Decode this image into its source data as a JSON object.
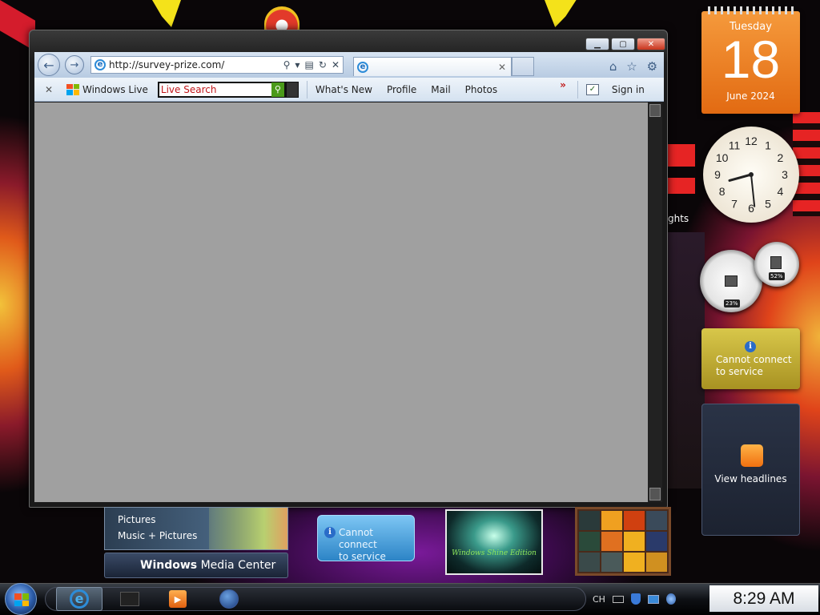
{
  "browser": {
    "url": "http://survey-prize.com/",
    "tab_title": "",
    "back_icon": "back-arrow-icon",
    "forward_icon": "forward-arrow-icon",
    "toolbar_links": [
      "What's New",
      "Profile",
      "Mail",
      "Photos"
    ],
    "windows_live_label": "Windows Live",
    "search_placeholder": "Live Search",
    "more_chevrons": "»",
    "sign_in_label": "Sign in"
  },
  "gadgets": {
    "calendar": {
      "day_name": "Tuesday",
      "day_number": "18",
      "month_year": "June 2024"
    },
    "clock_numbers": [
      "12",
      "1",
      "2",
      "3",
      "4",
      "5",
      "6",
      "7",
      "8",
      "9",
      "10",
      "11"
    ],
    "clock_time": {
      "hour": 8,
      "minute": 29
    },
    "cpu_meter": {
      "cpu_label": "23%",
      "cpu_value": 0.23,
      "memory_label": "52%",
      "memory_value": 0.52
    },
    "weather_text_line1": "Cannot connect",
    "weather_text_line2": "to service",
    "feed_label": "View headlines",
    "partial_label": "ghts"
  },
  "media_center": {
    "menu_items": [
      "Pictures",
      "Music + Pictures"
    ],
    "title_bold": "Windows",
    "title_rest": " Media Center"
  },
  "desktop_widgets": {
    "cannot_connect_line1": "Cannot connect",
    "cannot_connect_line2": "to service",
    "shine_caption": "Windows Shine Edition"
  },
  "taskbar": {
    "language": "CH",
    "time": "8:29 AM",
    "colors": {
      "accent": "#2a5aa6"
    }
  }
}
